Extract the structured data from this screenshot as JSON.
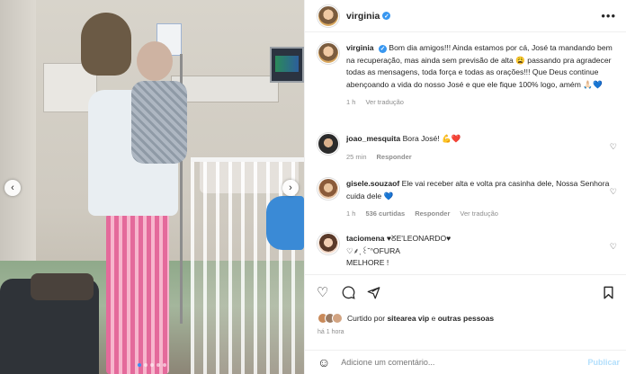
{
  "post": {
    "username": "virginia",
    "verified_mark": "✓",
    "more_label": "•••"
  },
  "caption": {
    "username": "virginia",
    "text": "Bom dia amigos!!! Ainda estamos por cá, José ta mandando bem na recuperação, mas ainda sem previsão de alta 😩 passando pra agradecer todas as mensagens, toda força e todas as orações!!! Que Deus continue abençoando a vida do nosso José e que ele fique 100% logo, amém 🙏🏻💙",
    "time": "1 h",
    "translate": "Ver tradução"
  },
  "comments": [
    {
      "username": "joao_mesquita",
      "text": "Bora José! 💪❤️",
      "time": "25 min",
      "reply": "Responder"
    },
    {
      "username": "gisele.souzaof",
      "text": "Ele vai receber alta e volta pra casinha dele, Nossa Senhora cuida dele 💙",
      "time": "1 h",
      "likes": "536 curtidas",
      "reply": "Responder",
      "translate": "Ver tradução"
    },
    {
      "username": "taciomena",
      "text": "♥ᘜE'LEONARDO♥\n♡⸙ˎ꒰˘ᐢOFURA\nMELHORE !"
    }
  ],
  "liked_by": {
    "prefix": "Curtido por",
    "user": "sitearea vip",
    "connector": "e",
    "others": "outras pessoas"
  },
  "time_ago": "há 1 hora",
  "add_comment": {
    "placeholder": "Adicione um comentário...",
    "publish": "Publicar"
  },
  "icons": {
    "heart": "heart-icon",
    "comment": "comment-icon",
    "share": "share-icon",
    "bookmark": "bookmark-icon",
    "emoji": "emoji-icon",
    "prev": "chevron-left-icon",
    "next": "chevron-right-icon"
  },
  "colors": {
    "verified": "#3897f0",
    "muted": "#8e8e8e",
    "active_dot": "#3d8ff5",
    "publish": "#b2dffc"
  },
  "carousel": {
    "total_slides": 5,
    "active_slide": 1
  }
}
